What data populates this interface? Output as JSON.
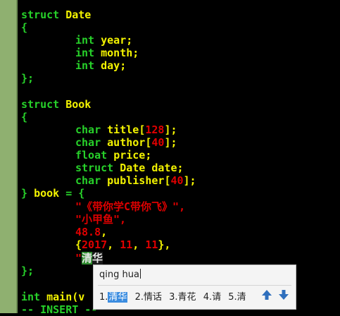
{
  "code": {
    "struct_date": {
      "kw": "struct",
      "name": "Date"
    },
    "open_brace": "{",
    "close_brace_semi": "};",
    "date_fields": [
      {
        "type": "int",
        "name": "year;"
      },
      {
        "type": "int",
        "name": "month;"
      },
      {
        "type": "int",
        "name": "day;"
      }
    ],
    "struct_book": {
      "kw": "struct",
      "name": "Book"
    },
    "book_fields": {
      "title": {
        "type": "char",
        "name": "title",
        "lb": "[",
        "size": "128",
        "rb": "];"
      },
      "author": {
        "type": "char",
        "name": "author",
        "lb": "[",
        "size": "40",
        "rb": "];"
      },
      "price": {
        "type": "float",
        "name": "price;"
      },
      "date": {
        "type": "struct",
        "type2": "Date",
        "name": "date;"
      },
      "publisher": {
        "type": "char",
        "name": "publisher",
        "lb": "[",
        "size": "40",
        "rb": "];"
      }
    },
    "book_init": {
      "close": "}",
      "name": "book",
      "assign": "= {"
    },
    "init_values": {
      "title": "\"《带你学C带你飞》\",",
      "author": "\"小甲鱼\",",
      "price": "48.8",
      "price_comma": ",",
      "date_open": "{",
      "y": "2017",
      "m": "11",
      "d": "11",
      "date_close": "},",
      "sep": ", ",
      "quote": "\"",
      "ime_selected": "清",
      "ime_preedit": "华"
    },
    "main_line": {
      "kw": "int",
      "rest": "main(v"
    },
    "status": "-- INSERT --"
  },
  "ime": {
    "pinyin": "qing hua",
    "candidates": [
      {
        "num": "1.",
        "text": "清华",
        "selected": true
      },
      {
        "num": "2.",
        "text": "情话"
      },
      {
        "num": "3.",
        "text": "青花"
      },
      {
        "num": "4.",
        "text": "请"
      },
      {
        "num": "5.",
        "text": "清"
      }
    ],
    "prev_icon": "arrow-up-icon",
    "next_icon": "arrow-down-icon",
    "accent": "#3c8de0"
  }
}
